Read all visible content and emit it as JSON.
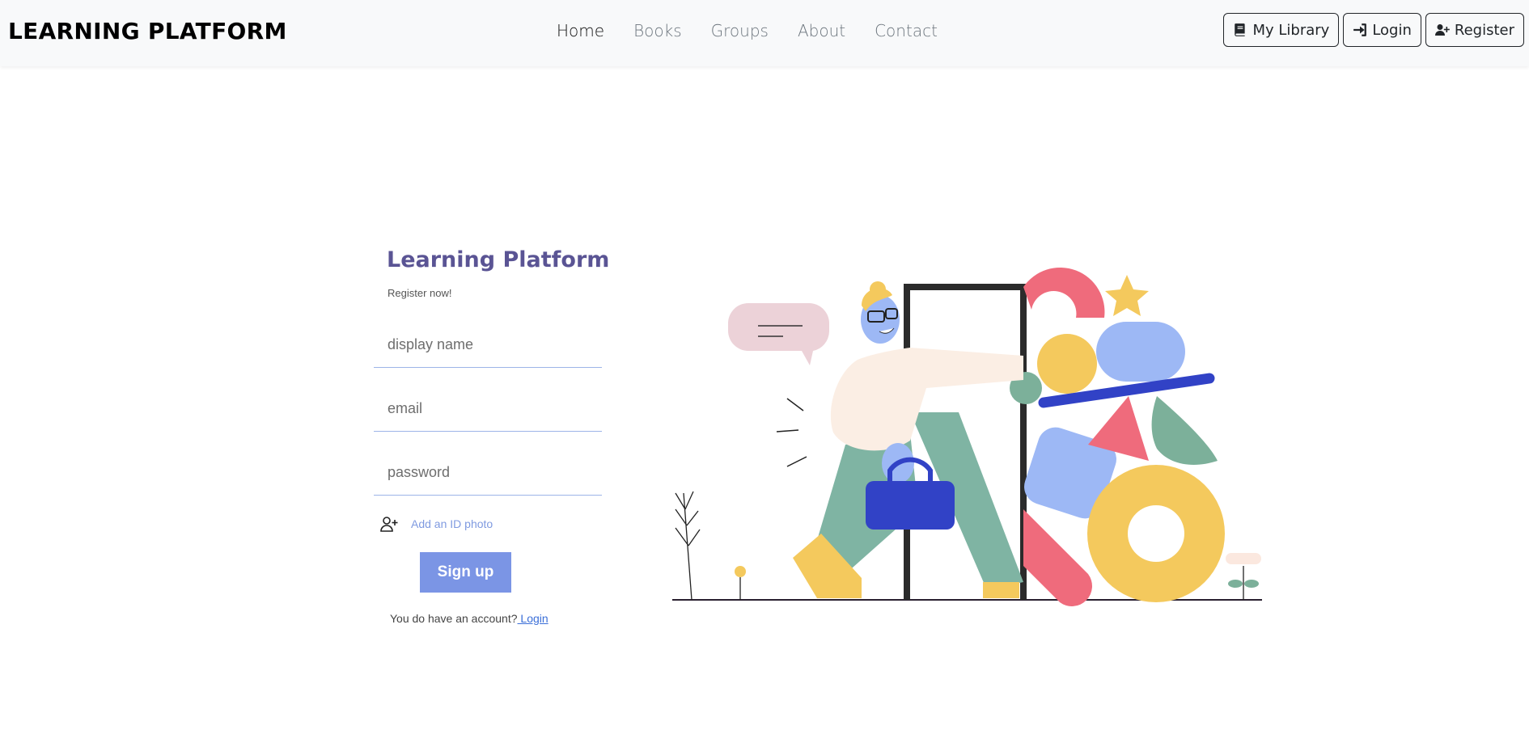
{
  "navbar": {
    "brand": "LEARNING PLATFORM",
    "links": [
      {
        "label": "Home",
        "active": true
      },
      {
        "label": "Books",
        "active": false
      },
      {
        "label": "Groups",
        "active": false
      },
      {
        "label": "About",
        "active": false
      },
      {
        "label": "Contact",
        "active": false
      }
    ],
    "buttons": {
      "library": {
        "label": "My Library",
        "icon": "book-icon"
      },
      "login": {
        "label": "Login",
        "icon": "sign-in-icon"
      },
      "register": {
        "label": "Register",
        "icon": "user-plus-icon"
      }
    }
  },
  "form": {
    "title": "Learning Platform",
    "subtitle": "Register now!",
    "display_name_placeholder": "display name",
    "email_placeholder": "email",
    "password_placeholder": "password",
    "photo_label": "Add an ID photo",
    "photo_icon": "user-plus-icon",
    "signup_label": "Sign up",
    "have_account_text": "You do have an account?",
    "login_link": " Login"
  },
  "colors": {
    "accent": "#7b95e5",
    "title": "#5a5494",
    "navbar_bg": "#f8f9fa"
  }
}
